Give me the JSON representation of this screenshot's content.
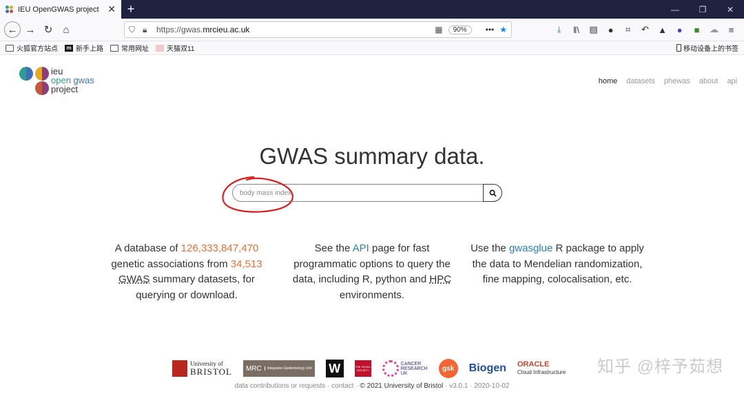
{
  "browser": {
    "tab_title": "IEU OpenGWAS project",
    "tab_close": "✕",
    "new_tab": "+",
    "url_prefix": "https://gwas.",
    "url_domain": "mrcieu.ac.uk",
    "zoom": "90%",
    "bookmarks": [
      "火狐官方站点",
      "新手上路",
      "常用网址",
      "天猫双11"
    ],
    "mobile_bookmarks": "移动设备上的书签"
  },
  "logo": {
    "line1": "ieu",
    "line2a": "open ",
    "line2b": "gwas",
    "line3": "project",
    "colors": [
      "#2a9e8f",
      "#3f6fb5",
      "#e6a827",
      "#8a3f7a",
      "#c25a3a"
    ]
  },
  "nav": {
    "items": [
      {
        "label": "home",
        "active": true
      },
      {
        "label": "datasets",
        "active": false
      },
      {
        "label": "phewas",
        "active": false
      },
      {
        "label": "about",
        "active": false
      },
      {
        "label": "api",
        "active": false
      }
    ]
  },
  "hero": {
    "title": "GWAS summary data."
  },
  "search": {
    "placeholder": "body mass index"
  },
  "columns": {
    "c1": {
      "pre": "A database of ",
      "num1": "126,333,847,470",
      "mid": "genetic associations from ",
      "num2": "34,513",
      "abbr": "GWAS",
      "post1": " summary datasets, for",
      "post2": "querying or download."
    },
    "c2": {
      "pre": "See the ",
      "link": "API",
      "post1": " page for fast",
      "post2": "programmatic options to query the",
      "post3": "data, including R, python and ",
      "abbr": "HPC",
      "post4": "environments."
    },
    "c3": {
      "pre": "Use the ",
      "link": "gwasglue",
      "post1": " R package to apply",
      "post2": "the data to Mendelian randomization,",
      "post3": "fine mapping, colocalisation, etc."
    }
  },
  "sponsors": {
    "uob_top": "University of",
    "uob_bottom": "BRISTOL",
    "mrc": "MRC",
    "mrc_sub": "Integrative Epidemiology Unit",
    "wellcome": "W",
    "royal": "THE ROYAL SOCIETY",
    "cruk1": "CANCER",
    "cruk2": "RESEARCH",
    "cruk3": "UK",
    "gsk": "gsk",
    "biogen": "Biogen",
    "oracle": "ORACLE",
    "oracle_sub": "Cloud Infrastructure"
  },
  "footer": {
    "a": "data contributions or requests",
    "b": "contact",
    "c": "© 2021 University of Bristol",
    "d": "v3.0.1 · 2020-10-02"
  },
  "watermark": "知乎 @梓予茹想"
}
